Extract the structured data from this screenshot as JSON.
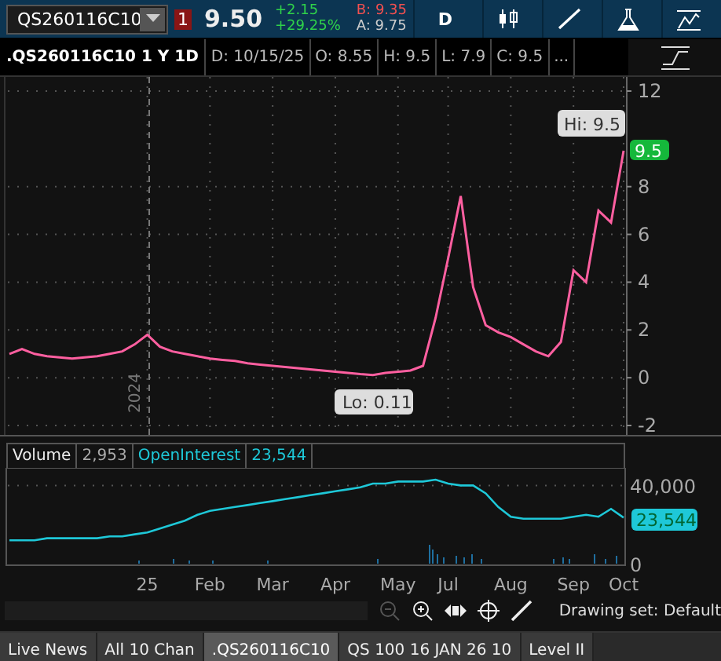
{
  "toolbar": {
    "symbol": "QS260116C10",
    "alert_count": "1",
    "last": "9.50",
    "change": "+2.15",
    "change_pct": "+29.25%",
    "bid": "B: 9.35",
    "ask": "A: 9.75",
    "aggregation": "D"
  },
  "header": {
    "title": ".QS260116C10 1 Y 1D",
    "fields": [
      "D: 10/15/25",
      "O: 8.55",
      "H: 9.5",
      "L: 7.9",
      "C: 9.5",
      "..."
    ]
  },
  "price_chart": {
    "year_marker": "2024",
    "hi_label": "Hi: 9.5",
    "lo_label": "Lo: 0.11",
    "last_badge": "9.5",
    "chart_data": {
      "type": "line",
      "series": [
        {
          "color": "#ff5fa0",
          "values": [
            1.0,
            1.2,
            1.0,
            0.9,
            0.85,
            0.8,
            0.85,
            0.9,
            1.0,
            1.1,
            1.4,
            1.8,
            1.3,
            1.1,
            1.0,
            0.9,
            0.8,
            0.75,
            0.7,
            0.6,
            0.55,
            0.5,
            0.45,
            0.4,
            0.35,
            0.3,
            0.25,
            0.2,
            0.15,
            0.11,
            0.2,
            0.25,
            0.3,
            0.5,
            2.5,
            5.0,
            7.6,
            3.8,
            2.2,
            1.9,
            1.7,
            1.4,
            1.1,
            0.9,
            1.5,
            4.5,
            4.0,
            7.0,
            6.5,
            9.5
          ]
        }
      ],
      "ylim": [
        -2,
        12
      ],
      "yticks": [
        -2,
        0,
        2,
        4,
        6,
        8,
        12
      ],
      "grid": true
    }
  },
  "volume_panel": {
    "volume_label": "Volume",
    "volume": "2,953",
    "oi": "23,544",
    "oi_badge": "23,544",
    "chart_data": {
      "type": "line",
      "ylim": [
        0,
        49000
      ],
      "yticks": [
        0,
        {
          "value": 40000,
          "label": "40,000"
        }
      ],
      "grid": true,
      "categories": [
        null,
        null,
        null,
        null,
        null,
        null,
        null,
        null,
        null,
        null,
        null,
        "25",
        null,
        null,
        null,
        null,
        "Feb",
        null,
        null,
        null,
        null,
        "Mar",
        null,
        null,
        null,
        null,
        "Apr",
        null,
        null,
        null,
        null,
        "May",
        null,
        null,
        null,
        "Jul",
        null,
        null,
        null,
        null,
        "Aug",
        null,
        null,
        null,
        null,
        "Sep",
        null,
        null,
        null,
        "Oct"
      ],
      "series": [
        {
          "name": "OpenInterest",
          "color": "#1ec8d8",
          "values": [
            12000,
            12000,
            12000,
            13000,
            13000,
            13000,
            13000,
            13000,
            14000,
            14000,
            15000,
            16000,
            18000,
            20000,
            22000,
            25000,
            27000,
            28000,
            29000,
            30000,
            31000,
            32000,
            33000,
            34000,
            35000,
            36000,
            37000,
            38000,
            39000,
            41000,
            41000,
            42000,
            42000,
            42000,
            43000,
            41000,
            40000,
            40000,
            36000,
            29000,
            24000,
            23000,
            23000,
            23000,
            23000,
            24000,
            25000,
            24000,
            28000,
            23544
          ]
        }
      ]
    }
  },
  "drawing_set": "Drawing set: Default",
  "tabs": [
    {
      "label": "Live News",
      "selected": false
    },
    {
      "label": "All 10 Chan",
      "selected": false
    },
    {
      "label": ".QS260116C10",
      "selected": true
    },
    {
      "label": "QS 100 16 JAN 26 10",
      "selected": false
    },
    {
      "label": "Level II",
      "selected": false
    }
  ]
}
